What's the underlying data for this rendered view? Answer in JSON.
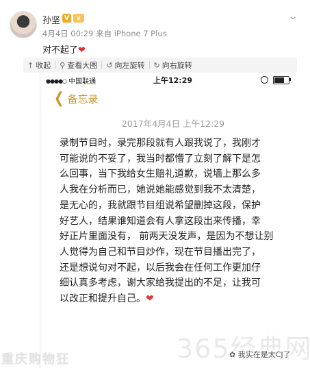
{
  "post": {
    "username": "孙坚",
    "verified_badge": "V",
    "level_badge": "♛",
    "meta": "4月4日 00:29 来自 iPhone 7 Plus",
    "text": "对不起了",
    "text_emoji": "❤"
  },
  "toolbar": {
    "items": [
      {
        "icon": "collapse-icon",
        "glyph": "↑",
        "label": "收起"
      },
      {
        "icon": "magnify-icon",
        "glyph": "⚲",
        "label": "查看大图"
      },
      {
        "icon": "rotate-left-icon",
        "glyph": "↺",
        "label": "向左旋转"
      },
      {
        "icon": "rotate-right-icon",
        "glyph": "↻",
        "label": "向右旋转"
      }
    ]
  },
  "screenshot": {
    "carrier": "中国联通",
    "carrier_signal": "●●●●○",
    "time": "上午12:29",
    "back_label": "备忘录",
    "note_date": "2017年4月4日 上午12:29",
    "note_lines": [
      "录制节目时，录完那段就有人跟我说了，我刚才",
      "可能说的不妥了，我当时都懵了立刻了解下是怎",
      "么回事，当下我给女生赔礼道歉，说墙上那么多",
      "人我在分析而已，她说她能感觉到我不太清楚，",
      "是无心的，我就跟节目组说希望删掉这段，保护",
      "好艺人，结果谁知道会有人拿这段出来传播，幸",
      "好正片里面没有，   前两天没发声，是因为不想让别",
      "人觉得为自己和节目炒作，现在节目播出完了，",
      "还是想说句对不起，以后我会在任何工作更加仔",
      "细认真多考虑，谢大家给我提出的不足，让我可",
      "以改正和提升自己。"
    ],
    "note_end_emoji": "❤"
  },
  "watermarks": {
    "left": "重庆购物狂",
    "right": "365经典网",
    "wechat": "我实在是太CJ了"
  },
  "colors": {
    "accent_gold": "#c9962a",
    "heart_red": "#d93a3a",
    "toolbar_bg": "#f4f4f4"
  }
}
